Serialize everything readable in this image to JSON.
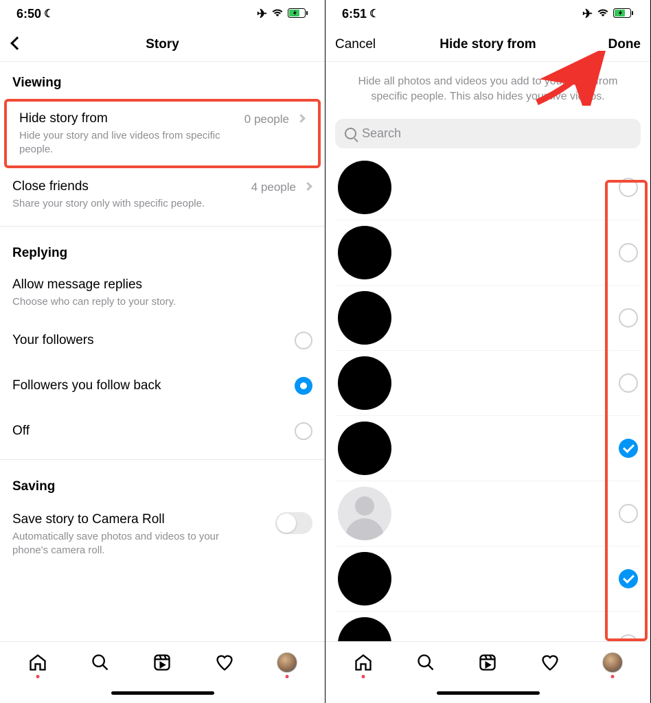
{
  "left": {
    "status_time": "6:50",
    "header_title": "Story",
    "sections": {
      "viewing": "Viewing",
      "replying": "Replying",
      "saving": "Saving"
    },
    "hide_story": {
      "title": "Hide story from",
      "sub": "Hide your story and live videos from specific people.",
      "value": "0 people"
    },
    "close_friends": {
      "title": "Close friends",
      "sub": "Share your story only with specific people.",
      "value": "4 people"
    },
    "allow_replies": {
      "title": "Allow message replies",
      "sub": "Choose who can reply to your story."
    },
    "radio_options": [
      {
        "label": "Your followers",
        "selected": false
      },
      {
        "label": "Followers you follow back",
        "selected": true
      },
      {
        "label": "Off",
        "selected": false
      }
    ],
    "save_camera": {
      "title": "Save story to Camera Roll",
      "sub": "Automatically save photos and videos to your phone's camera roll."
    }
  },
  "right": {
    "status_time": "6:51",
    "nav_cancel": "Cancel",
    "nav_title": "Hide story from",
    "nav_done": "Done",
    "description": "Hide all photos and videos you add to your story from specific people. This also hides your live videos.",
    "search_placeholder": "Search",
    "people": [
      {
        "avatar": "black",
        "checked": false
      },
      {
        "avatar": "black",
        "checked": false
      },
      {
        "avatar": "black",
        "checked": false
      },
      {
        "avatar": "black",
        "checked": false
      },
      {
        "avatar": "black",
        "checked": true
      },
      {
        "avatar": "gray",
        "checked": false
      },
      {
        "avatar": "black",
        "checked": true
      },
      {
        "avatar": "black",
        "checked": false
      }
    ]
  }
}
